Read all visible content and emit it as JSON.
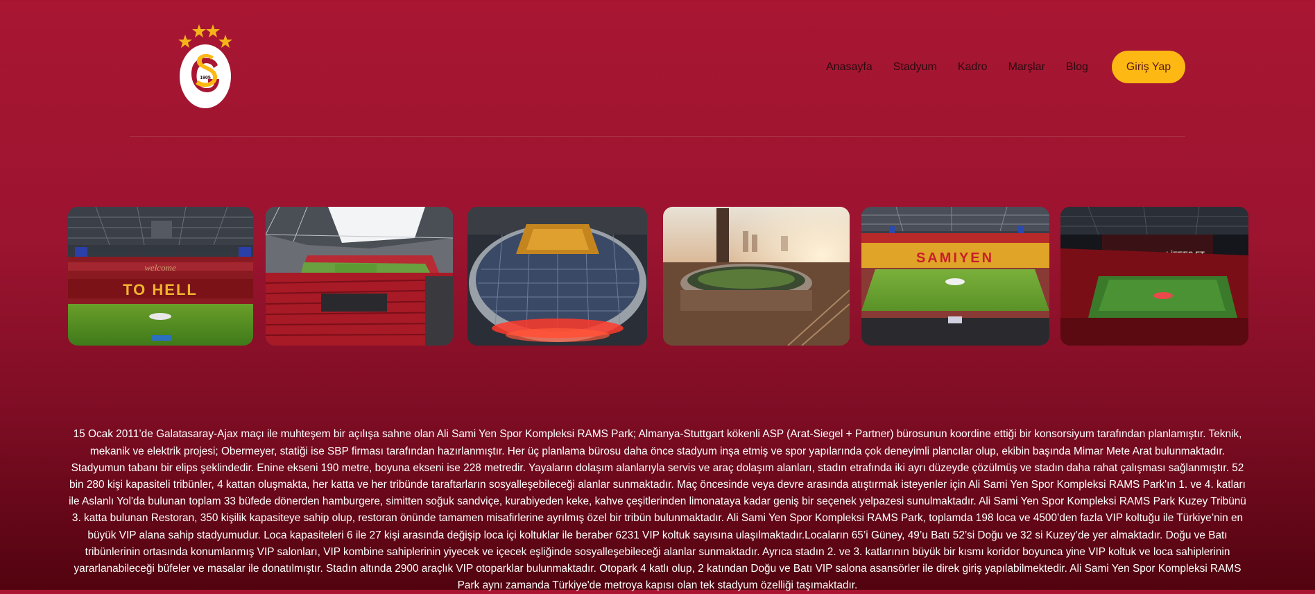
{
  "brand": {
    "logo_icon": "galatasaray-crest-icon",
    "year": "1905",
    "colors": {
      "red": "#a81632",
      "yellow": "#fdb813",
      "star": "#f4b41a"
    }
  },
  "nav": {
    "items": [
      {
        "label": "Anasayfa"
      },
      {
        "label": "Stadyum"
      },
      {
        "label": "Kadro"
      },
      {
        "label": "Marşlar"
      },
      {
        "label": "Blog"
      }
    ],
    "login_label": "Giriş Yap"
  },
  "gallery": {
    "photos": [
      {
        "name": "stadium-photo-to-hell",
        "banner_text_1": "welcome",
        "banner_text_2": "TO HELL"
      },
      {
        "name": "stadium-photo-stands"
      },
      {
        "name": "stadium-photo-aerial-solar"
      },
      {
        "name": "stadium-photo-skyline-sunset"
      },
      {
        "name": "stadium-photo-samiyen",
        "banner_text_1": "SAMIYEN"
      },
      {
        "name": "stadium-photo-night-tifo",
        "banner_text_1": "LİEEES FT"
      }
    ]
  },
  "description": "15 Ocak 2011’de Galatasaray-Ajax maçı ile muhteşem bir açılışa sahne olan Ali Sami Yen Spor Kompleksi RAMS Park; Almanya-Stuttgart kökenli ASP (Arat-Siegel + Partner) bürosunun koordine ettiği bir konsorsiyum tarafından planlamıştır. Teknik, mekanik ve elektrik projesi; Obermeyer, statiği ise SBP firması tarafından hazırlanmıştır. Her üç planlama bürosu daha önce stadyum inşa etmiş ve spor yapılarında çok deneyimli plancılar olup, ekibin başında Mimar Mete Arat bulunmaktadır. Stadyumun tabanı bir elips şeklindedir. Enine ekseni 190 metre, boyuna ekseni ise 228 metredir. Yayaların dolaşım alanlarıyla servis ve araç dolaşım alanları, stadın etrafında iki ayrı düzeyde çözülmüş ve stadın daha rahat çalışması sağlanmıştır. 52 bin 280 kişi kapasiteli tribünler, 4 kattan oluşmakta, her katta ve her tribünde taraftarların sosyalleşebileceği alanlar sunmaktadır. Maç öncesinde veya devre arasında atıştırmak isteyenler için Ali Sami Yen Spor Kompleksi RAMS Park'ın 1. ve 4. katları ile Aslanlı Yol'da bulunan toplam 33 büfede dönerden hamburgere, simitten soğuk sandviçe, kurabiyeden keke, kahve çeşitlerinden limonataya kadar geniş bir seçenek yelpazesi sunulmaktadır. Ali Sami Yen Spor Kompleksi RAMS Park Kuzey Tribünü 3. katta bulunan Restoran, 350 kişilik kapasiteye sahip olup, restoran önünde tamamen misafirlerine ayrılmış özel bir tribün bulunmaktadır. Ali Sami Yen Spor Kompleksi RAMS Park, toplamda 198 loca ve 4500’den fazla VIP koltuğu ile Türkiye’nin en büyük VIP alana sahip stadyumudur. Loca kapasiteleri 6 ile 27 kişi arasında değişip loca içi koltuklar ile beraber 6231 VIP koltuk sayısına ulaşılmaktadır.Locaların 65’i Güney, 49’u Batı 52’si Doğu ve 32 si Kuzey’de yer almaktadır. Doğu ve Batı tribünlerinin ortasında konumlanmış VIP salonları, VIP kombine sahiplerinin yiyecek ve içecek eşliğinde sosyalleşebileceği alanlar sunmaktadır. Ayrıca stadın 2. ve 3. katlarının büyük bir kısmı koridor boyunca yine VIP koltuk ve loca sahiplerinin yararlanabileceği büfeler ve masalar ile donatılmıştır. Stadın altında 2900 araçlık VIP otoparklar bulunmaktadır. Otopark 4 katlı olup, 2 katından Doğu ve Batı VIP salona asansörler ile direk giriş yapılabilmektedir. Ali Sami Yen Spor Kompleksi RAMS Park aynı zamanda Türkiye'de metroya kapısı olan tek stadyum özelliği taşımaktadır."
}
